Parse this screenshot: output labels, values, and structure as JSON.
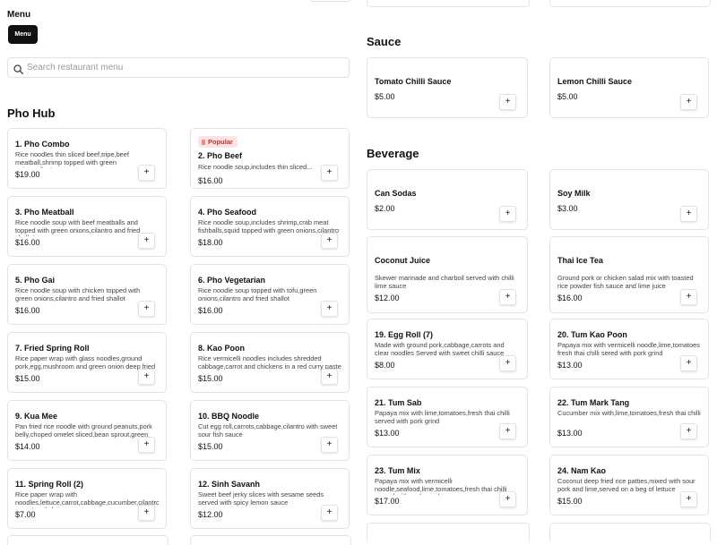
{
  "header": {
    "title": "Menu",
    "menu_button": "Menu"
  },
  "search": {
    "placeholder": "Search restaurant menu"
  },
  "sections": {
    "pho_hub": "Pho Hub",
    "sauce": "Sauce",
    "beverage": "Beverage"
  },
  "add_label": "+",
  "popular_badge": "Popular",
  "items": {
    "pho_combo": {
      "name": "1. Pho Combo",
      "desc": "Rice noodles thin sliced beef,tripe,beef meatball,shrimp topped with green onions,cilantro",
      "price": "$19.00"
    },
    "pho_beef": {
      "name": "2. Pho Beef",
      "desc": "Rice noodle soup,includes thin sliced...",
      "price": "$16.00"
    },
    "pho_meatball": {
      "name": "3. Pho Meatball",
      "desc": "Rice noodle soup with beef meatballs and topped with green onions,cilantro and fried shallot",
      "price": "$16.00"
    },
    "pho_seafood": {
      "name": "4. Pho Seafood",
      "desc": "Rice noodle soup,includes shrimp,crab meat fishballs,squid topped with green onions,cilantro",
      "price": "$18.00"
    },
    "pho_gai": {
      "name": "5. Pho Gai",
      "desc": "Rice noodle soup with chicken topped with green onions,cilantro and fried shallot",
      "price": "$16.00"
    },
    "pho_vegetarian": {
      "name": "6. Pho Vegetarian",
      "desc": "Rice noodle soup topped with tofu,green onions,cilantro and fried shallot",
      "price": "$16.00"
    },
    "fried_spring_roll": {
      "name": "7. Fried Spring Roll",
      "desc": "Rice paper wrap with glass noodles,ground pork,egg,mushroom and green onion deep fried",
      "price": "$15.00"
    },
    "kao_poon": {
      "name": "8. Kao Poon",
      "desc": "Rice vermicelli noodles includes shredded cabbage,carrot and chickens in a red curry paste",
      "price": "$15.00"
    },
    "kua_mee": {
      "name": "9. Kua Mee",
      "desc": "Pan fried rice noodle with ground peanuts,pork belly,choped omelet sliced,bean sprout,green",
      "price": "$14.00"
    },
    "bbq_noodle": {
      "name": "10. BBQ Noodle",
      "desc": "Cut egg roll,carrots,cabbage,cilantro with sweet sour fish sauce",
      "price": "$15.00"
    },
    "spring_roll": {
      "name": "11. Spring Roll (2)",
      "desc": "Rice paper wrap with noodles,lettuce,carrot,cabbage,cucumber,cilantro,bean sprout and shrimps or",
      "price": "$7.00"
    },
    "sinh_savanh": {
      "name": "12. Sinh Savanh",
      "desc": "Sweet beef jerky slices with sesame seeds served with spicy lemon sauce",
      "price": "$12.00"
    },
    "tomato_chilli": {
      "name": "Tomato Chilli Sauce",
      "price": "$5.00"
    },
    "lemon_chilli": {
      "name": "Lemon Chilli Sauce",
      "price": "$5.00"
    },
    "can_sodas": {
      "name": "Can Sodas",
      "price": "$2.00"
    },
    "soy_milk": {
      "name": "Soy Milk",
      "price": "$3.00"
    },
    "coconut_juice": {
      "name": "Coconut Juice",
      "desc": "Skewer marinade and charboil served with chilli lime sauce",
      "price": "$12.00"
    },
    "thai_ice_tea": {
      "name": "Thai Ice Tea",
      "desc": "Ground pork or chicken salad mix with toasted rice powder fish sauce and lime juice",
      "price": "$16.00"
    },
    "egg_roll": {
      "name": "19. Egg Roll (7)",
      "desc": "Made with ground pork,cabbage,carrots and clear noodles Served with sweet chilli sauce",
      "price": "$8.00"
    },
    "tum_kao_poon": {
      "name": "20. Tum Kao Poon",
      "desc": "Papaya mix with vermicelli noodle,lime,tomatoes fresh thai chilli sered with pork grind",
      "price": "$13.00"
    },
    "tum_sab": {
      "name": "21. Tum Sab",
      "desc": "Papaya mix with lime,tomatoes,fresh thai chilli served with pork grind",
      "price": "$13.00"
    },
    "tum_mark_tang": {
      "name": "22. Tum Mark Tang",
      "desc": "Cucumber mix with,lime,tomatoes,fresh thai chilli",
      "price": "$13.00"
    },
    "tum_mix": {
      "name": "23. Tum Mix",
      "desc": "Papaya mix with vermicelli noodle,seafood,lime,tomatoes,fresh thai chilli served with pork grind",
      "price": "$17.00"
    },
    "nam_kao": {
      "name": "24. Nam Kao",
      "desc": "Coconut deep fried rice patties,mixed with sour pork and lime,served on a beg of lettuce",
      "price": "$15.00"
    }
  }
}
